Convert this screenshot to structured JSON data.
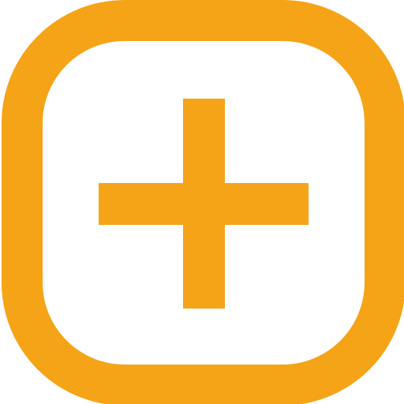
{
  "icon": {
    "name": "add-square-icon",
    "color": "#F5A418",
    "label": ""
  }
}
